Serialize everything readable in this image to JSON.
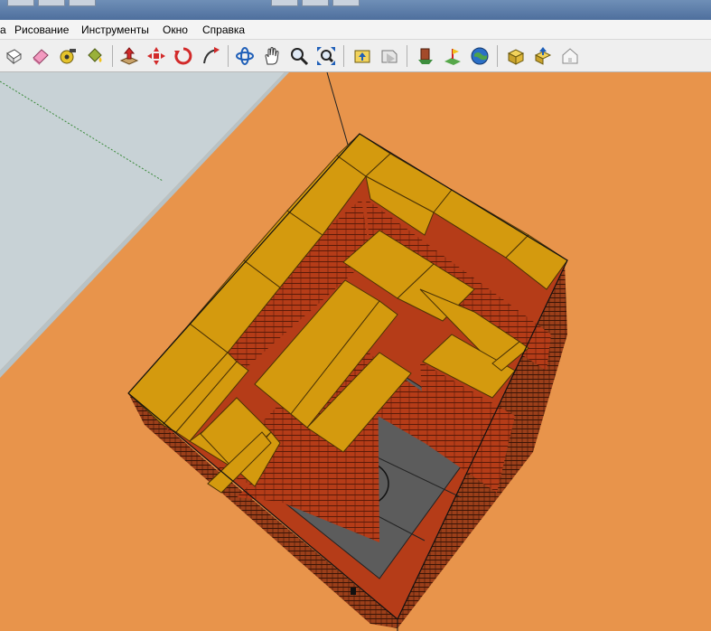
{
  "window": {
    "title_strip_buttons": 6
  },
  "menu": {
    "items": [
      {
        "label": "a"
      },
      {
        "label": "Рисование"
      },
      {
        "label": "Инструменты"
      },
      {
        "label": "Окно"
      },
      {
        "label": "Справка"
      }
    ]
  },
  "toolbar": {
    "tools": [
      {
        "icon": "box-select-icon"
      },
      {
        "icon": "eraser-icon"
      },
      {
        "icon": "tape-measure-icon"
      },
      {
        "icon": "paint-bucket-icon"
      },
      {
        "icon": "push-pull-icon"
      },
      {
        "icon": "move-icon"
      },
      {
        "icon": "rotate-icon"
      },
      {
        "icon": "follow-me-icon"
      },
      {
        "icon": "orbit-icon"
      },
      {
        "icon": "pan-hand-icon"
      },
      {
        "icon": "zoom-icon"
      },
      {
        "icon": "zoom-extents-icon"
      },
      {
        "icon": "get-models-icon"
      },
      {
        "icon": "share-model-icon"
      },
      {
        "icon": "place-model-icon"
      },
      {
        "icon": "add-location-icon"
      },
      {
        "icon": "google-earth-icon"
      },
      {
        "icon": "get-components-icon"
      },
      {
        "icon": "share-component-icon"
      },
      {
        "icon": "house-outline-icon"
      }
    ]
  },
  "colors": {
    "ground": "#e8944b",
    "brick_top": "#d49a0e",
    "brick_side": "#b53c18",
    "stove_plate": "#5c5c5c",
    "sky_panel": "#c8d2d6"
  }
}
